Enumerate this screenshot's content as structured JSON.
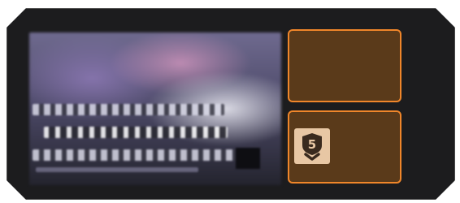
{
  "tier_badge": {
    "number": "5",
    "icon": "shield-chevron-icon"
  },
  "colors": {
    "accent": "#f0862a",
    "slot_fill": "#5a3a1a",
    "badge_bg": "#e8c7a4",
    "badge_fg": "#3a2a1e",
    "panel_bg": "#1c1c1e"
  }
}
